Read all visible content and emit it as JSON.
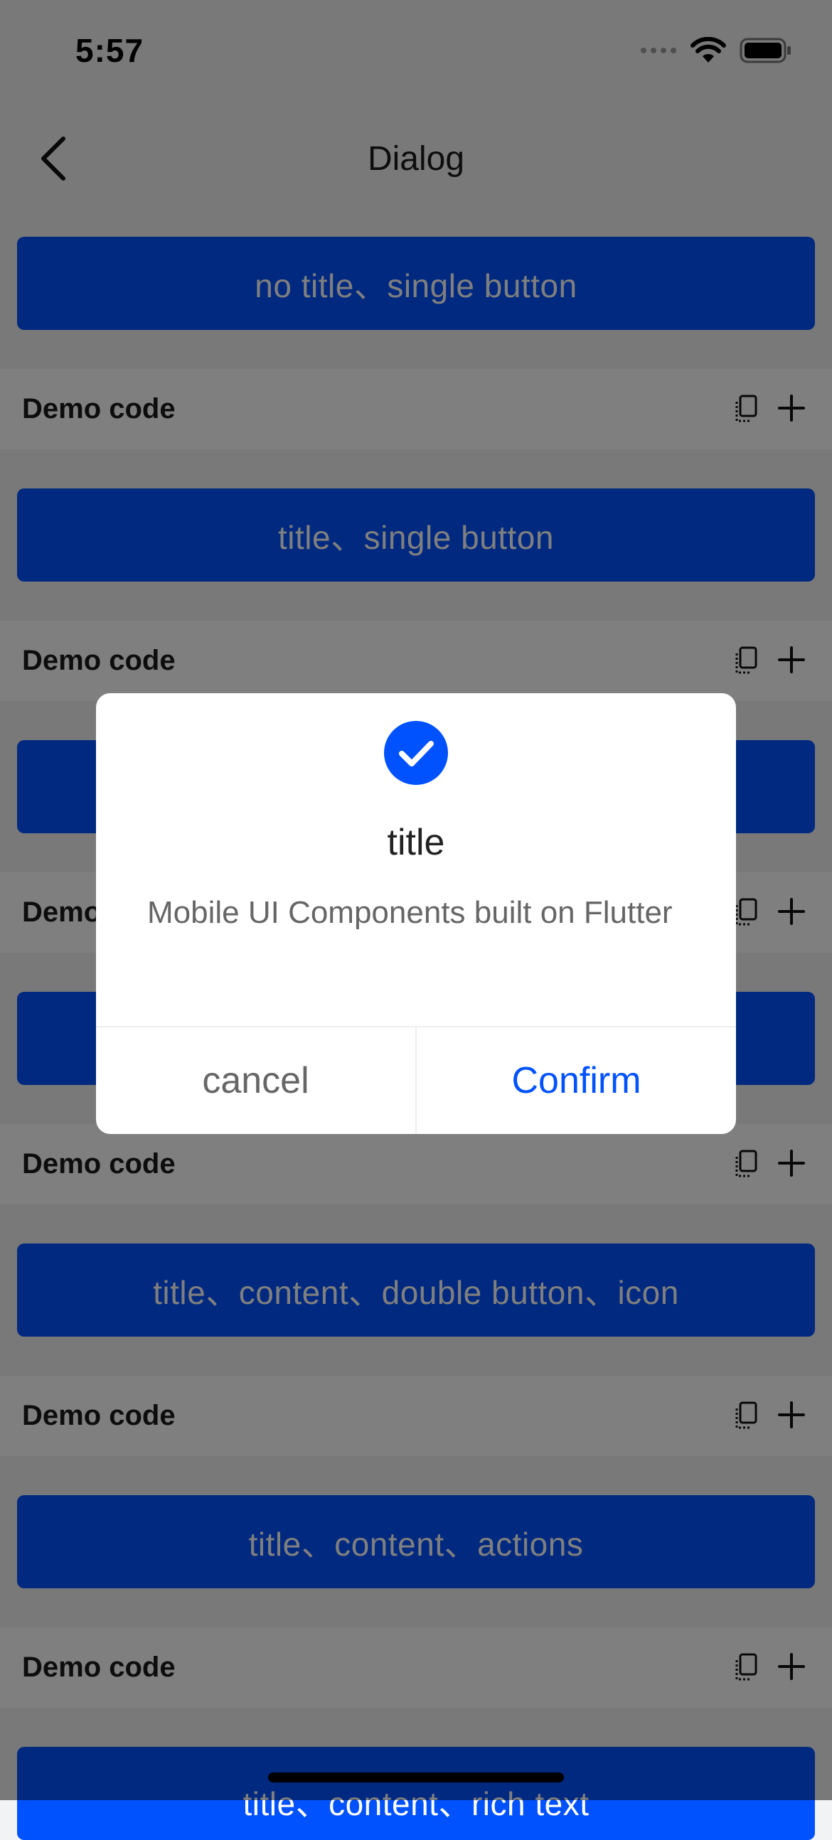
{
  "status_bar": {
    "time": "5:57"
  },
  "nav": {
    "title": "Dialog"
  },
  "demos": [
    {
      "button_label": "no title、single button",
      "code_label": "Demo code"
    },
    {
      "button_label": "title、single button",
      "code_label": "Demo code"
    },
    {
      "button_label": "",
      "code_label": "Demo code"
    },
    {
      "button_label": "",
      "code_label": "Demo code"
    },
    {
      "button_label": "title、content、double button、icon",
      "code_label": "Demo code"
    },
    {
      "button_label": "title、content、actions",
      "code_label": "Demo code"
    },
    {
      "button_label": "title、content、rich text"
    }
  ],
  "dialog": {
    "icon": "check-circle-icon",
    "title": "title",
    "message": "Mobile UI Components built on Flutter",
    "cancel_label": "cancel",
    "confirm_label": "Confirm"
  },
  "colors": {
    "brand": "#0052ff",
    "overlay": "rgba(0,0,0,0.5)"
  }
}
